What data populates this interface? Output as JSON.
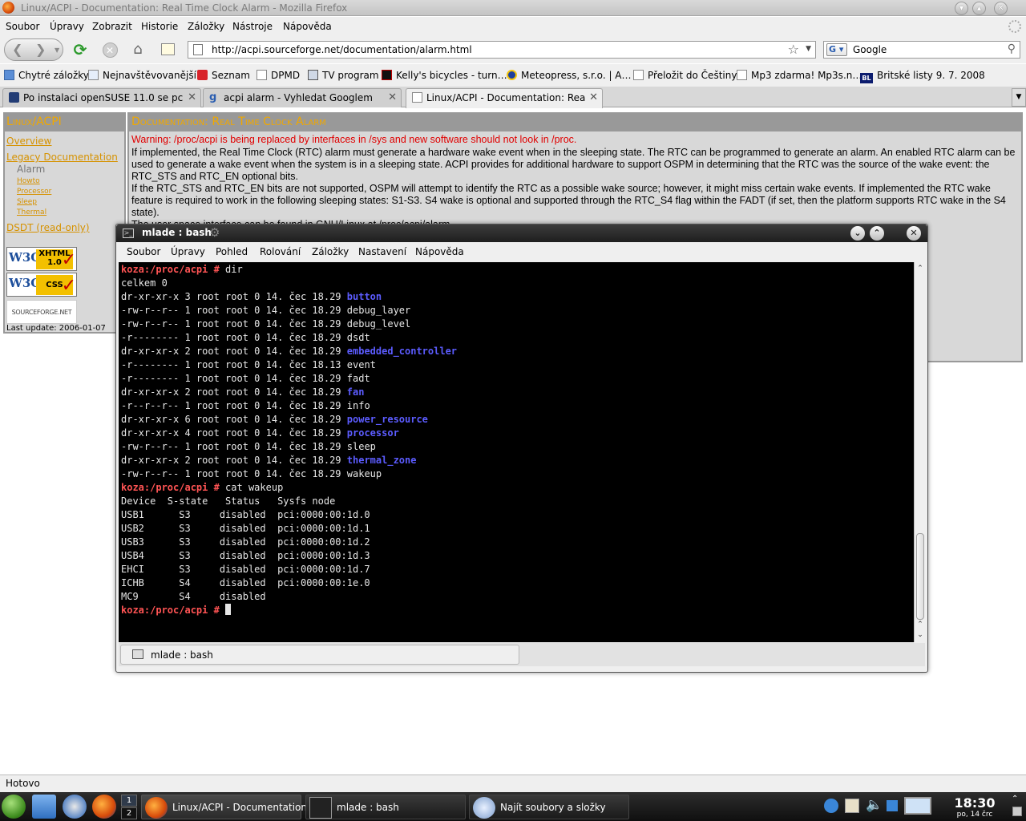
{
  "firefox": {
    "window_title": "Linux/ACPI - Documentation: Real Time Clock Alarm - Mozilla Firefox",
    "menu": [
      "Soubor",
      "Úpravy",
      "Zobrazit",
      "Historie",
      "Záložky",
      "Nástroje",
      "Nápověda"
    ],
    "url": "http://acpi.sourceforge.net/documentation/alarm.html",
    "search_value": "Google",
    "bookmarks": [
      "Chytré záložky",
      "Nejnavštěvovanější",
      "Seznam",
      "DPMD",
      "TV program",
      "Kelly's bicycles - turn…",
      "Meteopress, s.r.o. | A…",
      "Přeložit do Češtiny",
      "Mp3 zdarma! Mp3s.n…",
      "Britské listy 9. 7. 2008"
    ],
    "bookmark_badge": "BL",
    "tabs": [
      "Po instalaci openSUSE 11.0 se pc…",
      "acpi alarm - Vyhledat Googlem",
      "Linux/ACPI - Documentation: Real…"
    ],
    "status": "Hotovo"
  },
  "page": {
    "sidebar_title": "Linux/ACPI",
    "nav": {
      "overview": "Overview",
      "legacy": "Legacy Documentation",
      "alarm": "Alarm",
      "howto": "Howto",
      "processor": "Processor",
      "sleep": "Sleep",
      "thermal": "Thermal",
      "dsdt": "DSDT (read-only)"
    },
    "badges": {
      "w3c": "W3C",
      "xhtml": "XHTML",
      "xhtml_version": "1.0",
      "css": "CSS",
      "sourceforge": "SOURCEFORGE.NET"
    },
    "last_update": "Last update: 2006-01-07",
    "doc_title": "Documentation: Real Time Clock Alarm",
    "warning": "Warning: /proc/acpi is being replaced by interfaces in /sys and new software should not look in /proc.",
    "para1": "If implemented, the Real Time Clock (RTC) alarm must generate a hardware wake event when in the sleeping state. The RTC can be programmed to generate an alarm. An enabled RTC alarm can be used to generate a wake event when the system is in a sleeping state. ACPI provides for additional hardware to support OSPM in determining that the RTC was the source of the wake event: the RTC_STS and RTC_EN optional bits.",
    "para2": "If the RTC_STS and RTC_EN bits are not supported, OSPM will attempt to identify the RTC as a possible wake source; however, it might miss certain wake events. If implemented the RTC wake feature is required to work in the following sleeping states: S1-S3. S4 wake is optional and supported through the RTC_S4 flag within the FADT (if set, then the platform supports RTC wake in the S4 state).",
    "para3": "The user space interface can be found in GNU/Linux at /proc/acpi/alarm."
  },
  "konsole": {
    "title": "mlade : bash",
    "menu": [
      "Soubor",
      "Úpravy",
      "Pohled",
      "Rolování",
      "Záložky",
      "Nastavení",
      "Nápověda"
    ],
    "tab_label": "mlade : bash",
    "prompt": "koza:/proc/acpi #",
    "lines": [
      {
        "kind": "cmd",
        "text": "dir"
      },
      {
        "kind": "plain",
        "text": "celkem 0"
      },
      {
        "kind": "ls",
        "meta": "dr-xr-xr-x 3 root root 0 14. čec 18.29",
        "name": "button",
        "is_dir": true
      },
      {
        "kind": "ls",
        "meta": "-rw-r--r-- 1 root root 0 14. čec 18.29",
        "name": "debug_layer",
        "is_dir": false
      },
      {
        "kind": "ls",
        "meta": "-rw-r--r-- 1 root root 0 14. čec 18.29",
        "name": "debug_level",
        "is_dir": false
      },
      {
        "kind": "ls",
        "meta": "-r-------- 1 root root 0 14. čec 18.29",
        "name": "dsdt",
        "is_dir": false
      },
      {
        "kind": "ls",
        "meta": "dr-xr-xr-x 2 root root 0 14. čec 18.29",
        "name": "embedded_controller",
        "is_dir": true
      },
      {
        "kind": "ls",
        "meta": "-r-------- 1 root root 0 14. čec 18.13",
        "name": "event",
        "is_dir": false
      },
      {
        "kind": "ls",
        "meta": "-r-------- 1 root root 0 14. čec 18.29",
        "name": "fadt",
        "is_dir": false
      },
      {
        "kind": "ls",
        "meta": "dr-xr-xr-x 2 root root 0 14. čec 18.29",
        "name": "fan",
        "is_dir": true
      },
      {
        "kind": "ls",
        "meta": "-r--r--r-- 1 root root 0 14. čec 18.29",
        "name": "info",
        "is_dir": false
      },
      {
        "kind": "ls",
        "meta": "dr-xr-xr-x 6 root root 0 14. čec 18.29",
        "name": "power_resource",
        "is_dir": true
      },
      {
        "kind": "ls",
        "meta": "dr-xr-xr-x 4 root root 0 14. čec 18.29",
        "name": "processor",
        "is_dir": true
      },
      {
        "kind": "ls",
        "meta": "-rw-r--r-- 1 root root 0 14. čec 18.29",
        "name": "sleep",
        "is_dir": false
      },
      {
        "kind": "ls",
        "meta": "dr-xr-xr-x 2 root root 0 14. čec 18.29",
        "name": "thermal_zone",
        "is_dir": true
      },
      {
        "kind": "ls",
        "meta": "-rw-r--r-- 1 root root 0 14. čec 18.29",
        "name": "wakeup",
        "is_dir": false
      },
      {
        "kind": "cmd",
        "text": "cat wakeup"
      },
      {
        "kind": "plain",
        "text": "Device  S-state   Status   Sysfs node"
      },
      {
        "kind": "plain",
        "text": "USB1      S3     disabled  pci:0000:00:1d.0"
      },
      {
        "kind": "plain",
        "text": "USB2      S3     disabled  pci:0000:00:1d.1"
      },
      {
        "kind": "plain",
        "text": "USB3      S3     disabled  pci:0000:00:1d.2"
      },
      {
        "kind": "plain",
        "text": "USB4      S3     disabled  pci:0000:00:1d.3"
      },
      {
        "kind": "plain",
        "text": "EHCI      S3     disabled  pci:0000:00:1d.7"
      },
      {
        "kind": "plain",
        "text": "ICHB      S4     disabled  pci:0000:00:1e.0"
      },
      {
        "kind": "plain",
        "text": "MC9       S4     disabled"
      },
      {
        "kind": "cmd",
        "text": "",
        "cursor": true
      }
    ]
  },
  "taskbar": {
    "pager": [
      "1",
      "2"
    ],
    "tasks": [
      "Linux/ACPI - Documentation:",
      "mlade : bash",
      "Najít soubory a složky"
    ],
    "time": "18:30",
    "date": "po, 14 črc"
  },
  "colors": {
    "prompt": "#ff5454",
    "dir": "#5c5cff",
    "page_accent": "#f0a800",
    "warning": "#e00000"
  }
}
